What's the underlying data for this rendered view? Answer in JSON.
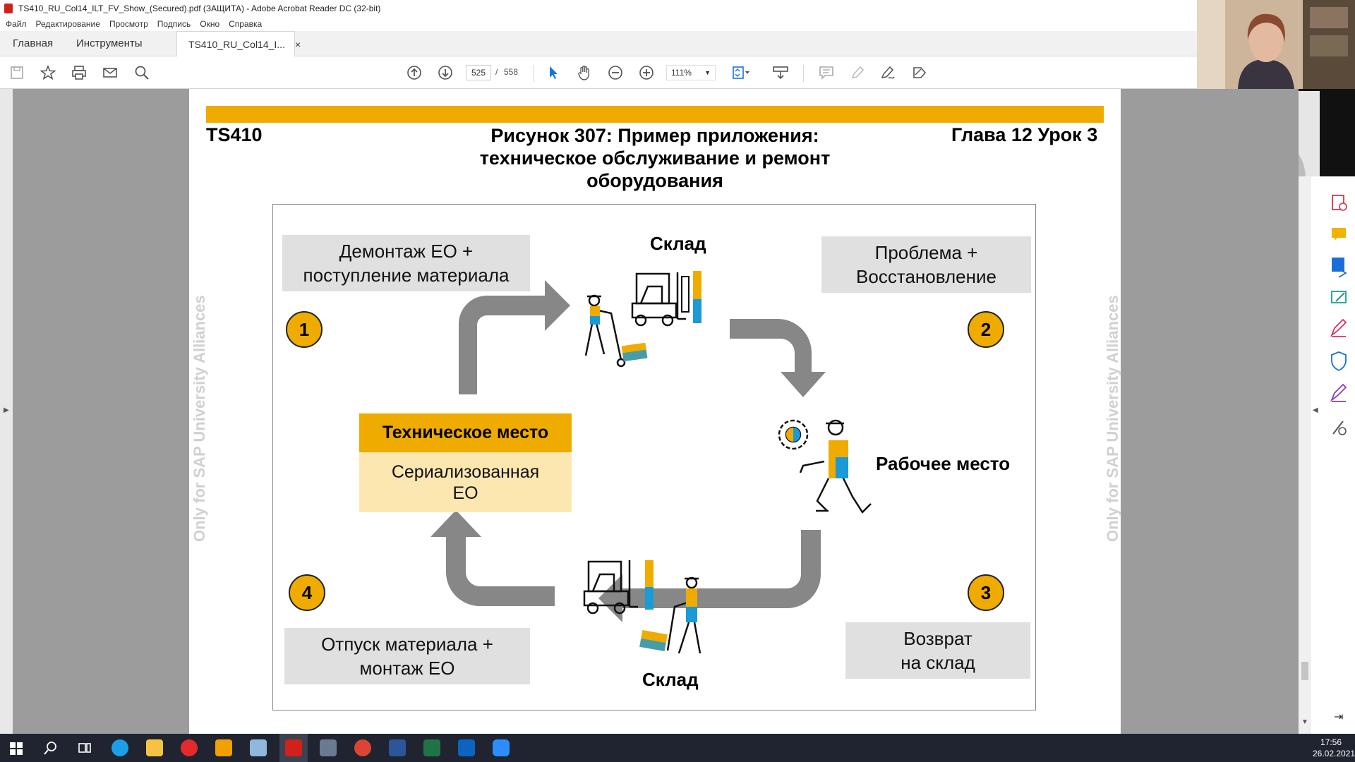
{
  "window": {
    "title": "TS410_RU_Col14_ILT_FV_Show_(Secured).pdf (ЗАЩИТА) - Adobe Acrobat Reader DC (32-bit)"
  },
  "menu": [
    "Файл",
    "Редактирование",
    "Просмотр",
    "Подпись",
    "Окно",
    "Справка"
  ],
  "tabs": {
    "home": "Главная",
    "tools": "Инструменты",
    "document": "TS410_RU_Col14_I...",
    "close": "×"
  },
  "toolbar": {
    "page_current": "525",
    "page_separator": "/",
    "page_total": "558",
    "zoom": "111%"
  },
  "slide": {
    "course": "TS410",
    "title_line1": "Рисунок 307: Пример приложения:",
    "title_line2": "техническое обслуживание и ремонт",
    "title_line3": "оборудования",
    "chapter": "Глава 12 Урок 3",
    "watermark": "Only for SAP University Alliances",
    "step1_line1": "Демонтаж ЕО +",
    "step1_line2": "поступление материала",
    "step2_line1": "Проблема +",
    "step2_line2": "Восстановление",
    "step3_line1": "Возврат",
    "step3_line2": "на склад",
    "step4_line1": "Отпуск материала +",
    "step4_line2": "монтаж ЕО",
    "n1": "1",
    "n2": "2",
    "n3": "3",
    "n4": "4",
    "warehouse_top": "Склад",
    "warehouse_bottom": "Склад",
    "workplace": "Рабочее место",
    "tech_place": "Техническое место",
    "serialized_line1": "Сериализованная",
    "serialized_line2": "ЕО"
  },
  "colors": {
    "accent": "#f0ab00",
    "box_grey": "#e0e0e0",
    "box_cream": "#fde7b1",
    "arrow": "#878787"
  },
  "clock": {
    "time": "17:56",
    "date": "26.02.2021"
  }
}
